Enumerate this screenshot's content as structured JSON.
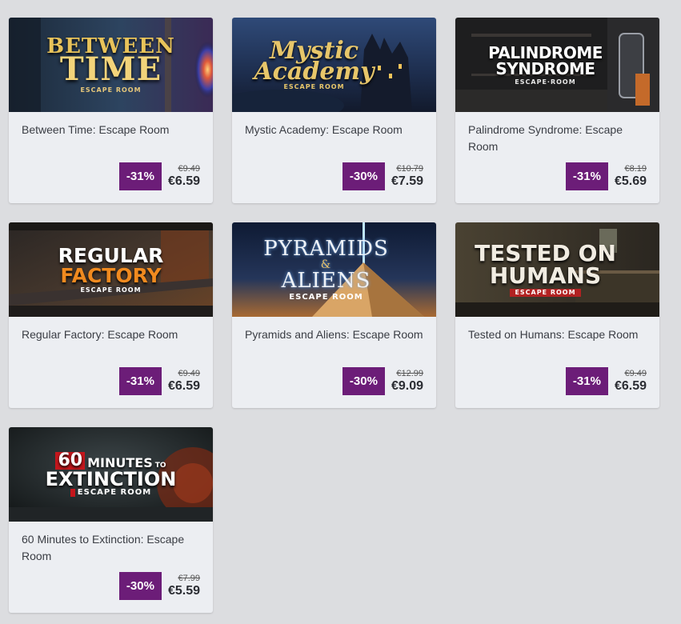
{
  "products": [
    {
      "title": "Between Time: Escape Room",
      "discount": "-31%",
      "old_price": "€9.49",
      "new_price": "€6.59",
      "logo": {
        "line1": "BETWEEN",
        "line2": "TIME",
        "sub": "ESCAPE ROOM"
      }
    },
    {
      "title": "Mystic Academy: Escape Room",
      "discount": "-30%",
      "old_price": "€10.79",
      "new_price": "€7.59",
      "logo": {
        "line1": "Mystic",
        "line2": "Academy",
        "sub": "ESCAPE ROOM"
      }
    },
    {
      "title": "Palindrome Syndrome: Escape Room",
      "discount": "-31%",
      "old_price": "€8.19",
      "new_price": "€5.69",
      "logo": {
        "line1": "PALINDROME",
        "line2": "SYNDROME",
        "sub": "ESCAPE·ROOM"
      }
    },
    {
      "title": "Regular Factory: Escape Room",
      "discount": "-31%",
      "old_price": "€9.49",
      "new_price": "€6.59",
      "logo": {
        "line1": "REGULAR",
        "line2": "FACTORY",
        "sub": "ESCAPE ROOM"
      }
    },
    {
      "title": "Pyramids and Aliens: Escape Room",
      "discount": "-30%",
      "old_price": "€12.99",
      "new_price": "€9.09",
      "logo": {
        "line1": "PYRAMIDS",
        "amp": "&",
        "line2": "ALIENS",
        "sub": "ESCAPE ROOM"
      }
    },
    {
      "title": "Tested on Humans: Escape Room",
      "discount": "-31%",
      "old_price": "€9.49",
      "new_price": "€6.59",
      "logo": {
        "line1": "TESTED ON",
        "line2": "HUMANS",
        "sub": "ESCAPE ROOM"
      }
    },
    {
      "title": "60 Minutes to Extinction: Escape Room",
      "discount": "-30%",
      "old_price": "€7.99",
      "new_price": "€5.59",
      "logo": {
        "num": "60",
        "line1": "MINUTES",
        "to": "TO",
        "line2": "EXTINCTION",
        "sub": "ESCAPE ROOM"
      }
    }
  ],
  "colors": {
    "page_bg": "#dcdde0",
    "card_bg": "#eceef2",
    "badge_bg": "#6c1d78",
    "text": "#3a3d44"
  }
}
